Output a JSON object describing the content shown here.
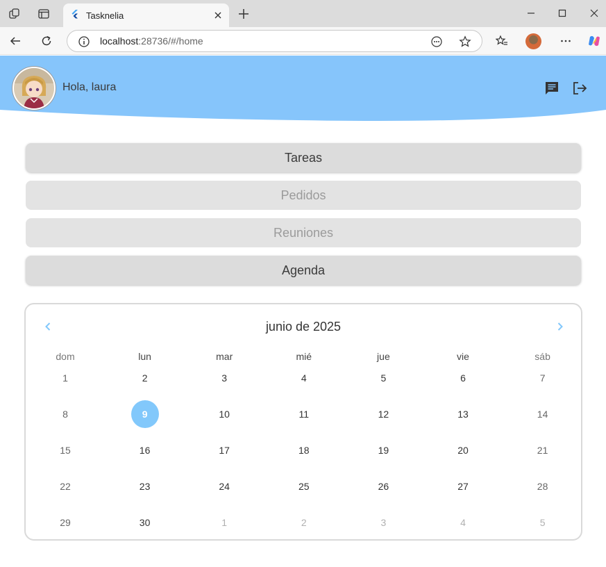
{
  "browser": {
    "tab_title": "Tasknelia",
    "url_host": "localhost",
    "url_rest": ":28736/#/home"
  },
  "header": {
    "greeting": "Hola, laura",
    "bg_color": "#86c5fb"
  },
  "menu": [
    {
      "label": "Tareas",
      "enabled": true
    },
    {
      "label": "Pedidos",
      "enabled": false
    },
    {
      "label": "Reuniones",
      "enabled": false
    },
    {
      "label": "Agenda",
      "enabled": true
    }
  ],
  "calendar": {
    "title": "junio de 2025",
    "weekdays": [
      "dom",
      "lun",
      "mar",
      "mié",
      "jue",
      "vie",
      "sáb"
    ],
    "selected_day": "9",
    "accent_color": "#82c8fb",
    "weeks": [
      [
        "1",
        "2",
        "3",
        "4",
        "5",
        "6",
        "7"
      ],
      [
        "8",
        "9",
        "10",
        "11",
        "12",
        "13",
        "14"
      ],
      [
        "15",
        "16",
        "17",
        "18",
        "19",
        "20",
        "21"
      ],
      [
        "22",
        "23",
        "24",
        "25",
        "26",
        "27",
        "28"
      ],
      [
        "29",
        "30",
        "1",
        "2",
        "3",
        "4",
        "5"
      ]
    ]
  }
}
